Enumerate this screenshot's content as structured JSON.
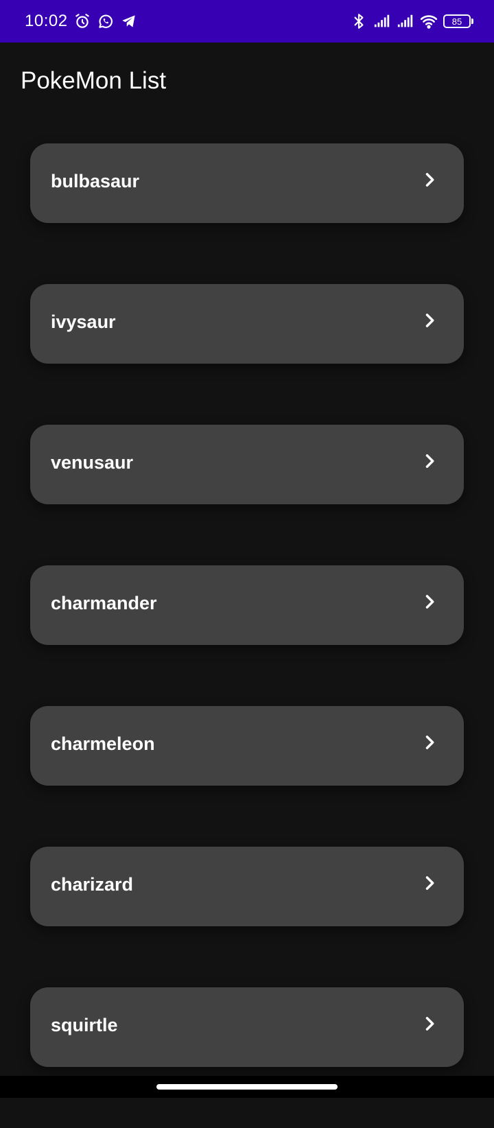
{
  "status_bar": {
    "time": "10:02",
    "left_icons": [
      "alarm-icon",
      "whatsapp-icon",
      "telegram-icon"
    ],
    "right_icons": [
      "bluetooth-icon",
      "signal-icon",
      "signal-icon",
      "wifi-icon"
    ],
    "battery_level": "85",
    "color": "#3700b3"
  },
  "app_bar": {
    "title": "PokeMon List"
  },
  "pokemon_list": {
    "items": [
      {
        "name": "bulbasaur"
      },
      {
        "name": "ivysaur"
      },
      {
        "name": "venusaur"
      },
      {
        "name": "charmander"
      },
      {
        "name": "charmeleon"
      },
      {
        "name": "charizard"
      },
      {
        "name": "squirtle"
      }
    ],
    "item_icon": "chevron-right-icon",
    "card_color": "#424242"
  },
  "background_color": "#121212"
}
